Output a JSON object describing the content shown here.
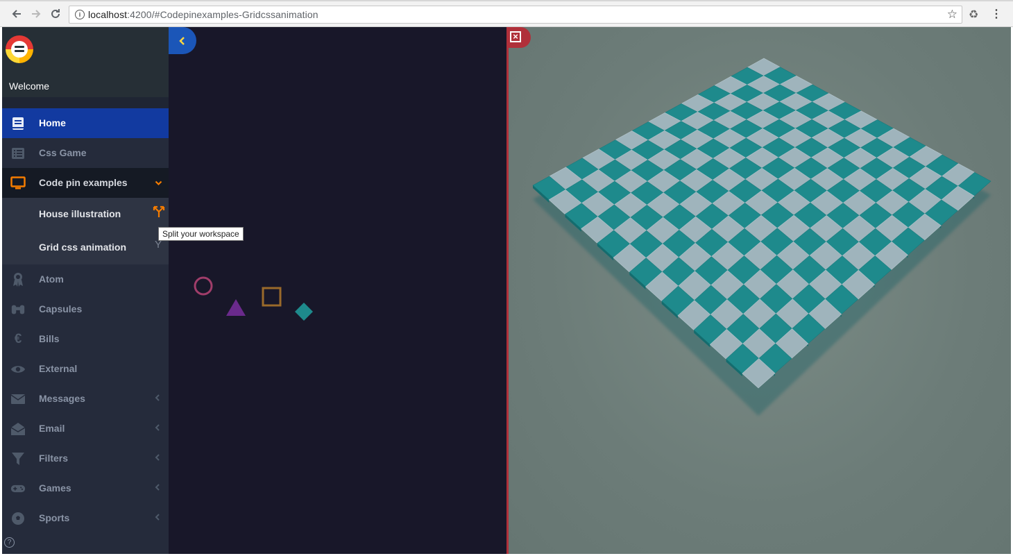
{
  "browser": {
    "url_host": "localhost",
    "url_path": ":4200/#Codepinexamples-Gridcssanimation",
    "back_icon": "arrow-left",
    "forward_icon": "arrow-right",
    "reload_icon": "reload",
    "star_icon": "star"
  },
  "sidebar": {
    "welcome": "Welcome",
    "items": [
      {
        "label": "Home",
        "icon": "book-icon",
        "state": "active"
      },
      {
        "label": "Css Game",
        "icon": "list-icon"
      },
      {
        "label": "Code pin examples",
        "icon": "monitor-icon",
        "state": "open"
      },
      {
        "label": "Atom",
        "icon": "award-icon"
      },
      {
        "label": "Capsules",
        "icon": "binoculars-icon"
      },
      {
        "label": "Bills",
        "icon": "euro-icon"
      },
      {
        "label": "External",
        "icon": "eye-icon"
      },
      {
        "label": "Messages",
        "icon": "envelope-icon",
        "has_arrow": true
      },
      {
        "label": "Email",
        "icon": "envelope-open-icon",
        "has_arrow": true
      },
      {
        "label": "Filters",
        "icon": "filter-icon",
        "has_arrow": true
      },
      {
        "label": "Games",
        "icon": "gamepad-icon",
        "has_arrow": true
      },
      {
        "label": "Sports",
        "icon": "soccer-ball-icon",
        "has_arrow": true
      }
    ],
    "subitems": [
      {
        "label": "House illustration"
      },
      {
        "label": "Grid css animation"
      }
    ]
  },
  "tooltip": "Split your workspace",
  "colors": {
    "accent_orange": "#f57c00",
    "active_blue": "#123aa0",
    "close_red": "#b0303a",
    "tile_teal": "#1e8a8c",
    "tile_light": "#9fb4bc"
  }
}
